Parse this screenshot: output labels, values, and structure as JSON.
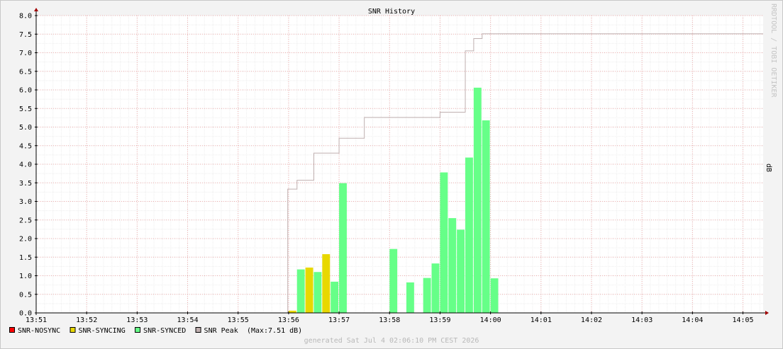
{
  "chart_data": {
    "type": "bar",
    "title": "SNR History",
    "ylabel": "dB",
    "watermark": "RRDTOOL / TOBI OETIKER",
    "footer": "generated Sat Jul  4 02:06:10 PM CEST 2026",
    "ylim": [
      0,
      8
    ],
    "y_ticks": [
      "0.0",
      "0.5",
      "1.0",
      "1.5",
      "2.0",
      "2.5",
      "3.0",
      "3.5",
      "4.0",
      "4.5",
      "5.0",
      "5.5",
      "6.0",
      "6.5",
      "7.0",
      "7.5",
      "8.0"
    ],
    "x_range": [
      "13:51",
      "14:05:24"
    ],
    "x_ticks": [
      "13:51",
      "13:52",
      "13:53",
      "13:54",
      "13:55",
      "13:56",
      "13:57",
      "13:58",
      "13:59",
      "14:00",
      "14:01",
      "14:02",
      "14:03",
      "14:04",
      "14:05"
    ],
    "grid": true,
    "legend_position": "bottom-left",
    "series": [
      {
        "name": "SNR-NOSYNC",
        "color": "#ff0000",
        "style": "bar",
        "points": []
      },
      {
        "name": "SNR-SYNCING",
        "color": "#e8d800",
        "style": "bar",
        "points": [
          {
            "x": "13:56:00",
            "y": 0.06
          },
          {
            "x": "13:56:20",
            "y": 1.22
          },
          {
            "x": "13:56:40",
            "y": 1.58
          }
        ]
      },
      {
        "name": "SNR-SYNCED",
        "color": "#66ff88",
        "style": "bar",
        "points": [
          {
            "x": "13:56:10",
            "y": 1.17
          },
          {
            "x": "13:56:30",
            "y": 1.1
          },
          {
            "x": "13:56:50",
            "y": 0.84
          },
          {
            "x": "13:57:00",
            "y": 3.49
          },
          {
            "x": "13:58:00",
            "y": 1.72
          },
          {
            "x": "13:58:20",
            "y": 0.82
          },
          {
            "x": "13:58:40",
            "y": 0.94
          },
          {
            "x": "13:58:50",
            "y": 1.33
          },
          {
            "x": "13:59:00",
            "y": 3.78
          },
          {
            "x": "13:59:10",
            "y": 2.55
          },
          {
            "x": "13:59:20",
            "y": 2.24
          },
          {
            "x": "13:59:30",
            "y": 4.18
          },
          {
            "x": "13:59:40",
            "y": 6.06
          },
          {
            "x": "13:59:50",
            "y": 5.18
          },
          {
            "x": "14:00:00",
            "y": 0.93
          }
        ]
      },
      {
        "name": "SNR Peak",
        "color": "#c0b0b0",
        "style": "step",
        "points": [
          {
            "x": "13:55:59",
            "y": 3.33
          },
          {
            "x": "13:56:10",
            "y": 3.57
          },
          {
            "x": "13:56:30",
            "y": 4.3
          },
          {
            "x": "13:57:00",
            "y": 4.7
          },
          {
            "x": "13:57:30",
            "y": 5.26
          },
          {
            "x": "13:59:00",
            "y": 5.4
          },
          {
            "x": "13:59:30",
            "y": 7.05
          },
          {
            "x": "13:59:40",
            "y": 7.38
          },
          {
            "x": "13:59:50",
            "y": 7.51
          },
          {
            "x": "14:05:24",
            "y": 7.51
          }
        ]
      }
    ],
    "peak_note": "(Max:7.51 dB)"
  }
}
